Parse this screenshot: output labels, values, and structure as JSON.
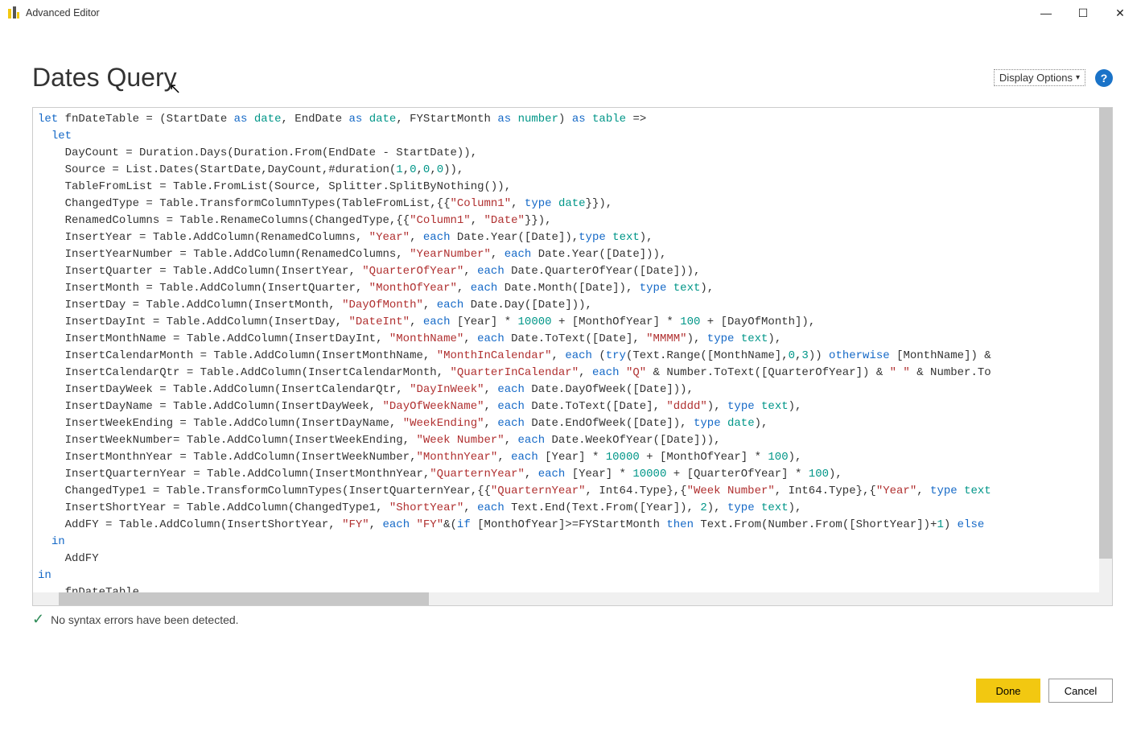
{
  "window": {
    "title": "Advanced Editor"
  },
  "header": {
    "page_title": "Dates Query",
    "display_options": "Display Options"
  },
  "status": {
    "message": "No syntax errors have been detected."
  },
  "buttons": {
    "done": "Done",
    "cancel": "Cancel"
  },
  "code": [
    [
      [
        "kw",
        "let"
      ],
      [
        "txt",
        " fnDateTable = (StartDate "
      ],
      [
        "kw",
        "as"
      ],
      [
        "txt",
        " "
      ],
      [
        "ty",
        "date"
      ],
      [
        "txt",
        ", EndDate "
      ],
      [
        "kw",
        "as"
      ],
      [
        "txt",
        " "
      ],
      [
        "ty",
        "date"
      ],
      [
        "txt",
        ", FYStartMonth "
      ],
      [
        "kw",
        "as"
      ],
      [
        "txt",
        " "
      ],
      [
        "ty",
        "number"
      ],
      [
        "txt",
        ") "
      ],
      [
        "kw",
        "as"
      ],
      [
        "txt",
        " "
      ],
      [
        "ty",
        "table"
      ],
      [
        "txt",
        " =>"
      ]
    ],
    [
      [
        "txt",
        "  "
      ],
      [
        "kw",
        "let"
      ]
    ],
    [
      [
        "txt",
        "    DayCount = Duration.Days(Duration.From(EndDate - StartDate)),"
      ]
    ],
    [
      [
        "txt",
        "    Source = List.Dates(StartDate,DayCount,#duration("
      ],
      [
        "num",
        "1"
      ],
      [
        "txt",
        ","
      ],
      [
        "num",
        "0"
      ],
      [
        "txt",
        ","
      ],
      [
        "num",
        "0"
      ],
      [
        "txt",
        ","
      ],
      [
        "num",
        "0"
      ],
      [
        "txt",
        ")),"
      ]
    ],
    [
      [
        "txt",
        "    TableFromList = Table.FromList(Source, Splitter.SplitByNothing()),"
      ]
    ],
    [
      [
        "txt",
        "    ChangedType = Table.TransformColumnTypes(TableFromList,{{"
      ],
      [
        "str",
        "\"Column1\""
      ],
      [
        "txt",
        ", "
      ],
      [
        "kw",
        "type"
      ],
      [
        "txt",
        " "
      ],
      [
        "ty",
        "date"
      ],
      [
        "txt",
        "}}),"
      ]
    ],
    [
      [
        "txt",
        "    RenamedColumns = Table.RenameColumns(ChangedType,{{"
      ],
      [
        "str",
        "\"Column1\""
      ],
      [
        "txt",
        ", "
      ],
      [
        "str",
        "\"Date\""
      ],
      [
        "txt",
        "}}),"
      ]
    ],
    [
      [
        "txt",
        "    InsertYear = Table.AddColumn(RenamedColumns, "
      ],
      [
        "str",
        "\"Year\""
      ],
      [
        "txt",
        ", "
      ],
      [
        "kw",
        "each"
      ],
      [
        "txt",
        " Date.Year([Date]),"
      ],
      [
        "kw",
        "type"
      ],
      [
        "txt",
        " "
      ],
      [
        "ty",
        "text"
      ],
      [
        "txt",
        "),"
      ]
    ],
    [
      [
        "txt",
        "    InsertYearNumber = Table.AddColumn(RenamedColumns, "
      ],
      [
        "str",
        "\"YearNumber\""
      ],
      [
        "txt",
        ", "
      ],
      [
        "kw",
        "each"
      ],
      [
        "txt",
        " Date.Year([Date])),"
      ]
    ],
    [
      [
        "txt",
        "    InsertQuarter = Table.AddColumn(InsertYear, "
      ],
      [
        "str",
        "\"QuarterOfYear\""
      ],
      [
        "txt",
        ", "
      ],
      [
        "kw",
        "each"
      ],
      [
        "txt",
        " Date.QuarterOfYear([Date])),"
      ]
    ],
    [
      [
        "txt",
        "    InsertMonth = Table.AddColumn(InsertQuarter, "
      ],
      [
        "str",
        "\"MonthOfYear\""
      ],
      [
        "txt",
        ", "
      ],
      [
        "kw",
        "each"
      ],
      [
        "txt",
        " Date.Month([Date]), "
      ],
      [
        "kw",
        "type"
      ],
      [
        "txt",
        " "
      ],
      [
        "ty",
        "text"
      ],
      [
        "txt",
        "),"
      ]
    ],
    [
      [
        "txt",
        "    InsertDay = Table.AddColumn(InsertMonth, "
      ],
      [
        "str",
        "\"DayOfMonth\""
      ],
      [
        "txt",
        ", "
      ],
      [
        "kw",
        "each"
      ],
      [
        "txt",
        " Date.Day([Date])),"
      ]
    ],
    [
      [
        "txt",
        "    InsertDayInt = Table.AddColumn(InsertDay, "
      ],
      [
        "str",
        "\"DateInt\""
      ],
      [
        "txt",
        ", "
      ],
      [
        "kw",
        "each"
      ],
      [
        "txt",
        " [Year] * "
      ],
      [
        "num",
        "10000"
      ],
      [
        "txt",
        " + [MonthOfYear] * "
      ],
      [
        "num",
        "100"
      ],
      [
        "txt",
        " + [DayOfMonth]),"
      ]
    ],
    [
      [
        "txt",
        "    InsertMonthName = Table.AddColumn(InsertDayInt, "
      ],
      [
        "str",
        "\"MonthName\""
      ],
      [
        "txt",
        ", "
      ],
      [
        "kw",
        "each"
      ],
      [
        "txt",
        " Date.ToText([Date], "
      ],
      [
        "str",
        "\"MMMM\""
      ],
      [
        "txt",
        "), "
      ],
      [
        "kw",
        "type"
      ],
      [
        "txt",
        " "
      ],
      [
        "ty",
        "text"
      ],
      [
        "txt",
        "),"
      ]
    ],
    [
      [
        "txt",
        "    InsertCalendarMonth = Table.AddColumn(InsertMonthName, "
      ],
      [
        "str",
        "\"MonthInCalendar\""
      ],
      [
        "txt",
        ", "
      ],
      [
        "kw",
        "each"
      ],
      [
        "txt",
        " ("
      ],
      [
        "kw",
        "try"
      ],
      [
        "txt",
        "(Text.Range([MonthName],"
      ],
      [
        "num",
        "0"
      ],
      [
        "txt",
        ","
      ],
      [
        "num",
        "3"
      ],
      [
        "txt",
        ")) "
      ],
      [
        "kw",
        "otherwise"
      ],
      [
        "txt",
        " [MonthName]) &"
      ]
    ],
    [
      [
        "txt",
        "    InsertCalendarQtr = Table.AddColumn(InsertCalendarMonth, "
      ],
      [
        "str",
        "\"QuarterInCalendar\""
      ],
      [
        "txt",
        ", "
      ],
      [
        "kw",
        "each"
      ],
      [
        "txt",
        " "
      ],
      [
        "str",
        "\"Q\""
      ],
      [
        "txt",
        " & Number.ToText([QuarterOfYear]) & "
      ],
      [
        "str",
        "\" \""
      ],
      [
        "txt",
        " & Number.To"
      ]
    ],
    [
      [
        "txt",
        "    InsertDayWeek = Table.AddColumn(InsertCalendarQtr, "
      ],
      [
        "str",
        "\"DayInWeek\""
      ],
      [
        "txt",
        ", "
      ],
      [
        "kw",
        "each"
      ],
      [
        "txt",
        " Date.DayOfWeek([Date])),"
      ]
    ],
    [
      [
        "txt",
        "    InsertDayName = Table.AddColumn(InsertDayWeek, "
      ],
      [
        "str",
        "\"DayOfWeekName\""
      ],
      [
        "txt",
        ", "
      ],
      [
        "kw",
        "each"
      ],
      [
        "txt",
        " Date.ToText([Date], "
      ],
      [
        "str",
        "\"dddd\""
      ],
      [
        "txt",
        "), "
      ],
      [
        "kw",
        "type"
      ],
      [
        "txt",
        " "
      ],
      [
        "ty",
        "text"
      ],
      [
        "txt",
        "),"
      ]
    ],
    [
      [
        "txt",
        "    InsertWeekEnding = Table.AddColumn(InsertDayName, "
      ],
      [
        "str",
        "\"WeekEnding\""
      ],
      [
        "txt",
        ", "
      ],
      [
        "kw",
        "each"
      ],
      [
        "txt",
        " Date.EndOfWeek([Date]), "
      ],
      [
        "kw",
        "type"
      ],
      [
        "txt",
        " "
      ],
      [
        "ty",
        "date"
      ],
      [
        "txt",
        "),"
      ]
    ],
    [
      [
        "txt",
        "    InsertWeekNumber= Table.AddColumn(InsertWeekEnding, "
      ],
      [
        "str",
        "\"Week Number\""
      ],
      [
        "txt",
        ", "
      ],
      [
        "kw",
        "each"
      ],
      [
        "txt",
        " Date.WeekOfYear([Date])),"
      ]
    ],
    [
      [
        "txt",
        "    InsertMonthnYear = Table.AddColumn(InsertWeekNumber,"
      ],
      [
        "str",
        "\"MonthnYear\""
      ],
      [
        "txt",
        ", "
      ],
      [
        "kw",
        "each"
      ],
      [
        "txt",
        " [Year] * "
      ],
      [
        "num",
        "10000"
      ],
      [
        "txt",
        " + [MonthOfYear] * "
      ],
      [
        "num",
        "100"
      ],
      [
        "txt",
        "),"
      ]
    ],
    [
      [
        "txt",
        "    InsertQuarternYear = Table.AddColumn(InsertMonthnYear,"
      ],
      [
        "str",
        "\"QuarternYear\""
      ],
      [
        "txt",
        ", "
      ],
      [
        "kw",
        "each"
      ],
      [
        "txt",
        " [Year] * "
      ],
      [
        "num",
        "10000"
      ],
      [
        "txt",
        " + [QuarterOfYear] * "
      ],
      [
        "num",
        "100"
      ],
      [
        "txt",
        "),"
      ]
    ],
    [
      [
        "txt",
        "    ChangedType1 = Table.TransformColumnTypes(InsertQuarternYear,{{"
      ],
      [
        "str",
        "\"QuarternYear\""
      ],
      [
        "txt",
        ", Int64.Type},{"
      ],
      [
        "str",
        "\"Week Number\""
      ],
      [
        "txt",
        ", Int64.Type},{"
      ],
      [
        "str",
        "\"Year\""
      ],
      [
        "txt",
        ", "
      ],
      [
        "kw",
        "type"
      ],
      [
        "txt",
        " "
      ],
      [
        "ty",
        "text"
      ]
    ],
    [
      [
        "txt",
        "    InsertShortYear = Table.AddColumn(ChangedType1, "
      ],
      [
        "str",
        "\"ShortYear\""
      ],
      [
        "txt",
        ", "
      ],
      [
        "kw",
        "each"
      ],
      [
        "txt",
        " Text.End(Text.From([Year]), "
      ],
      [
        "num",
        "2"
      ],
      [
        "txt",
        "), "
      ],
      [
        "kw",
        "type"
      ],
      [
        "txt",
        " "
      ],
      [
        "ty",
        "text"
      ],
      [
        "txt",
        "),"
      ]
    ],
    [
      [
        "txt",
        "    AddFY = Table.AddColumn(InsertShortYear, "
      ],
      [
        "str",
        "\"FY\""
      ],
      [
        "txt",
        ", "
      ],
      [
        "kw",
        "each"
      ],
      [
        "txt",
        " "
      ],
      [
        "str",
        "\"FY\""
      ],
      [
        "txt",
        "&("
      ],
      [
        "kw",
        "if"
      ],
      [
        "txt",
        " [MonthOfYear]>=FYStartMonth "
      ],
      [
        "kw",
        "then"
      ],
      [
        "txt",
        " Text.From(Number.From([ShortYear])+"
      ],
      [
        "num",
        "1"
      ],
      [
        "txt",
        ") "
      ],
      [
        "kw",
        "else"
      ]
    ],
    [
      [
        "txt",
        "  "
      ],
      [
        "kw",
        "in"
      ]
    ],
    [
      [
        "txt",
        "    AddFY"
      ]
    ],
    [
      [
        "kw",
        "in"
      ]
    ],
    [
      [
        "txt",
        "    fnDateTable"
      ]
    ]
  ]
}
